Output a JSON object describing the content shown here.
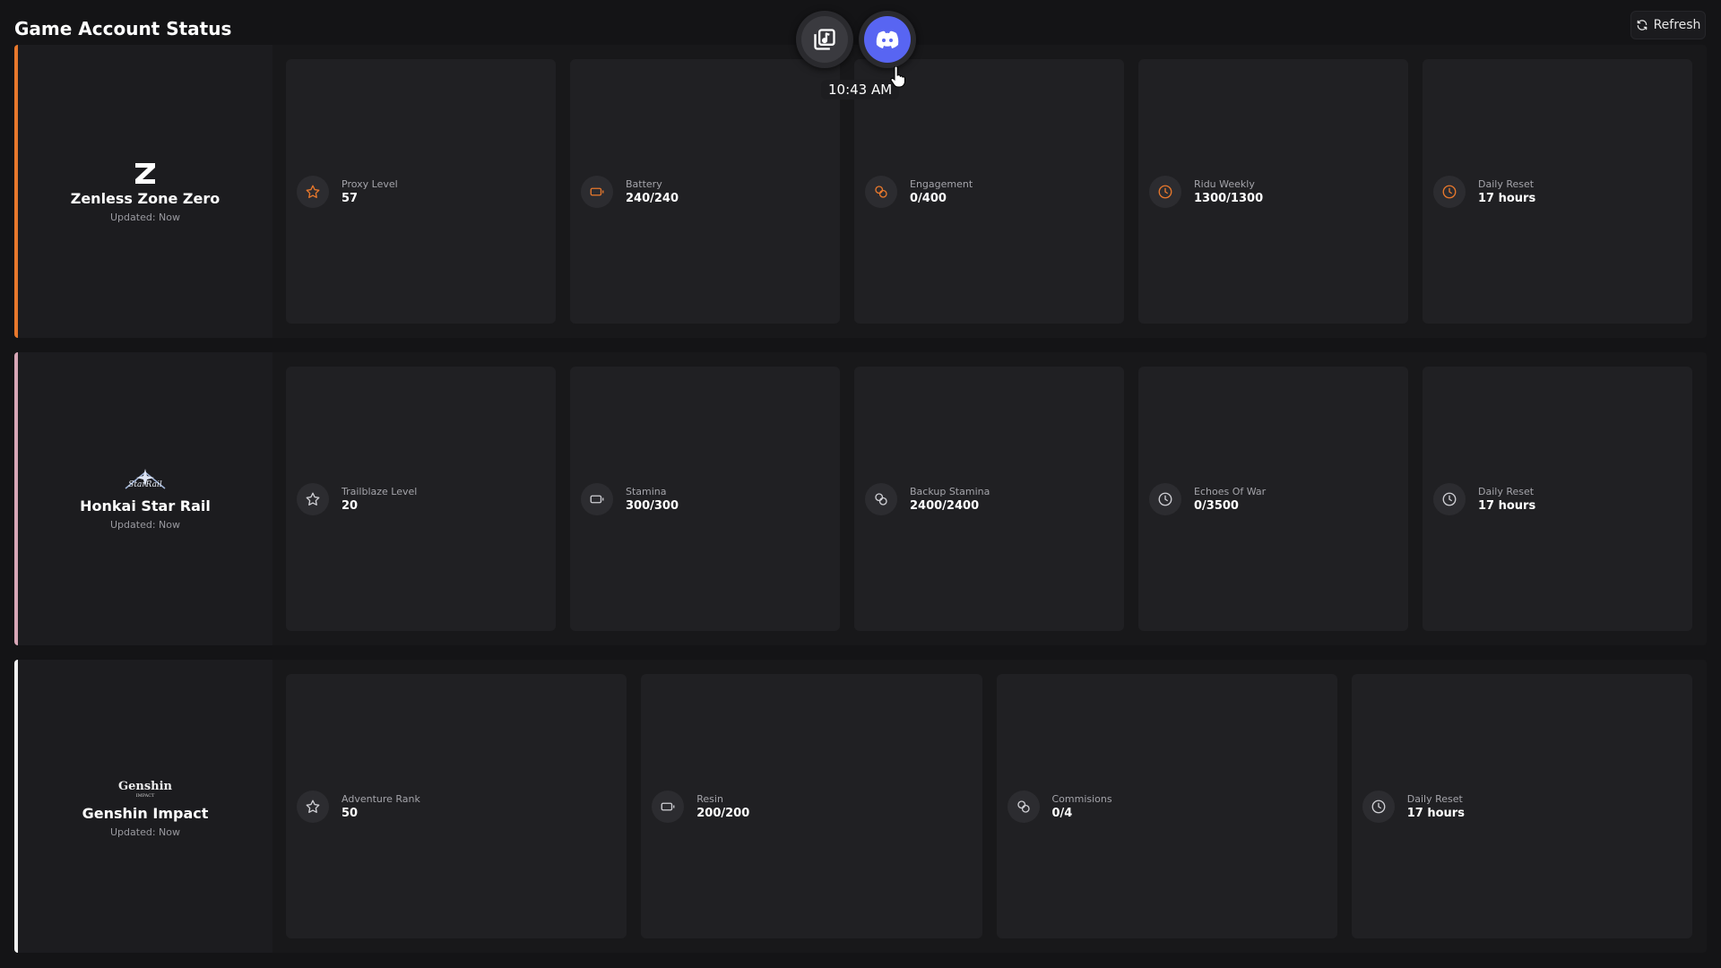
{
  "page": {
    "title": "Game Account Status"
  },
  "toolbar": {
    "refresh_label": "Refresh"
  },
  "overlay": {
    "time": "10:43 AM"
  },
  "colors": {
    "zzz_accent": "#e8782c",
    "hsr_accent": "#d7a6b6",
    "gi_accent": "#f2f2f2",
    "icon_zzz": "#e8782c",
    "icon_neutral": "#cfcfd4",
    "discord": "#5865f2"
  },
  "games": [
    {
      "name": "Zenless Zone Zero",
      "updated": "Updated: Now",
      "logo_text": "Z",
      "stats": [
        {
          "label": "Proxy Level",
          "value": "57",
          "icon": "star-icon"
        },
        {
          "label": "Battery",
          "value": "240/240",
          "icon": "battery-icon"
        },
        {
          "label": "Engagement",
          "value": "0/400",
          "icon": "coins-icon"
        },
        {
          "label": "Ridu Weekly",
          "value": "1300/1300",
          "icon": "clock-icon"
        },
        {
          "label": "Daily Reset",
          "value": "17 hours",
          "icon": "clock-icon"
        }
      ]
    },
    {
      "name": "Honkai Star Rail",
      "updated": "Updated: Now",
      "logo_text": "StarRail",
      "stats": [
        {
          "label": "Trailblaze Level",
          "value": "20",
          "icon": "star-icon"
        },
        {
          "label": "Stamina",
          "value": "300/300",
          "icon": "battery-icon"
        },
        {
          "label": "Backup Stamina",
          "value": "2400/2400",
          "icon": "coins-icon"
        },
        {
          "label": "Echoes Of War",
          "value": "0/3500",
          "icon": "clock-icon"
        },
        {
          "label": "Daily Reset",
          "value": "17 hours",
          "icon": "clock-icon"
        }
      ]
    },
    {
      "name": "Genshin Impact",
      "updated": "Updated: Now",
      "logo_text": "Genshin",
      "stats": [
        {
          "label": "Adventure Rank",
          "value": "50",
          "icon": "star-icon"
        },
        {
          "label": "Resin",
          "value": "200/200",
          "icon": "battery-icon"
        },
        {
          "label": "Commisions",
          "value": "0/4",
          "icon": "coins-icon"
        },
        {
          "label": "Daily Reset",
          "value": "17 hours",
          "icon": "clock-icon"
        }
      ]
    }
  ]
}
